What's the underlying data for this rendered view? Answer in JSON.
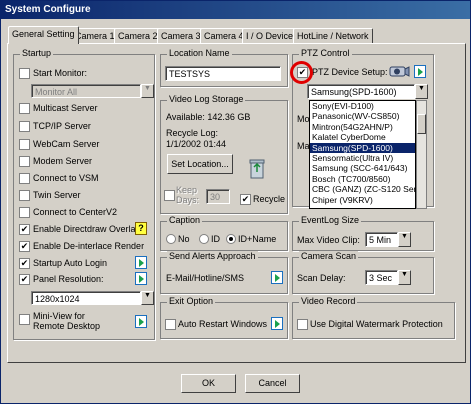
{
  "window": {
    "title": "System Configure"
  },
  "tabs": [
    "General Setting",
    "Camera 1",
    "Camera 2",
    "Camera 3",
    "Camera 4",
    "I / O Device",
    "HotLine / Network"
  ],
  "startup": {
    "title": "Startup",
    "start_monitor": "Start Monitor:",
    "monitor_value": "Monitor All",
    "multicast": "Multicast Server",
    "tcpip": "TCP/IP Server",
    "webcam": "WebCam Server",
    "modem": "Modem Server",
    "connect_vsm": "Connect to VSM",
    "twin": "Twin Server",
    "connect_centerv2": "Connect to CenterV2",
    "directdraw": "Enable Directdraw Overlay",
    "deinterlace": "Enable De-interlace Render",
    "auto_login": "Startup Auto Login",
    "panel_res": "Panel Resolution:",
    "resolution": "1280x1024",
    "miniview_1": "Mini-View for",
    "miniview_2": "Remote Desktop"
  },
  "location": {
    "title": "Location Name",
    "value": "TESTSYS"
  },
  "video_log": {
    "title": "Video Log Storage",
    "available": "Available: 142.36 GB",
    "recycle_log": "Recycle Log:",
    "recycle_date": "1/1/2002 01:44",
    "set_location": "Set Location...",
    "keep": "Keep",
    "days": "Days:",
    "days_value": "30",
    "recycle": "Recycle"
  },
  "caption": {
    "title": "Caption",
    "no": "No",
    "id": "ID",
    "id_name": "ID+Name"
  },
  "alerts": {
    "title": "Send Alerts Approach",
    "text": "E-Mail/Hotline/SMS"
  },
  "exit": {
    "title": "Exit Option",
    "text": "Auto Restart Windows"
  },
  "ptz": {
    "title": "PTZ Control",
    "device_setup": "PTZ Device Setup:",
    "selected": "Samsung(SPD-1600)",
    "options": [
      "Sony(EVI-D100)",
      "Panasonic(WV-CS850)",
      "Mintron(54G2AHN/P)",
      "Kalatel CyberDome",
      "Samsung(SPD-1600)",
      "Sensormatic(Ultra IV)",
      "Samsung (SCC-641/643)",
      "Bosch (TC700/8560)",
      "CBC (GANZ) (ZC-S120 Series)",
      "Chiper (V9KRV)"
    ],
    "selected_index": 4,
    "partial_label": "Mo",
    "partial_label2": "Ma"
  },
  "eventlog": {
    "title": "EventLog Size",
    "max_clip": "Max Video Clip:",
    "value": "5 Min"
  },
  "camera_scan": {
    "title": "Camera Scan",
    "scan_delay": "Scan Delay:",
    "value": "3 Sec"
  },
  "video_record": {
    "title": "Video Record",
    "text": "Use Digital Watermark Protection"
  },
  "buttons": {
    "ok": "OK",
    "cancel": "Cancel"
  },
  "icons": {
    "help": "?",
    "check": "✔"
  }
}
